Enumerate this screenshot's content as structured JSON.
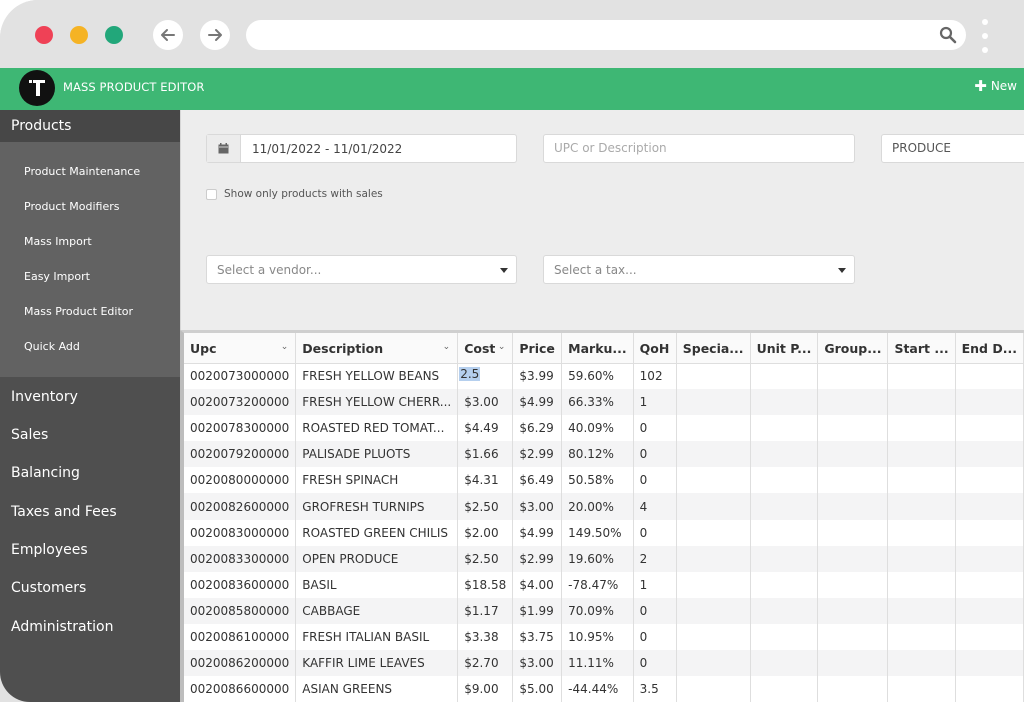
{
  "browser": {
    "traffic_lights": [
      "close",
      "minimize",
      "maximize"
    ],
    "url": ""
  },
  "app": {
    "title": "MASS PRODUCT EDITOR",
    "new_label": "New",
    "brand_color": "#3eb774"
  },
  "sidebar": {
    "active_section": "Products",
    "sub_items": [
      {
        "label": "Product Maintenance"
      },
      {
        "label": "Product Modifiers"
      },
      {
        "label": "Mass Import"
      },
      {
        "label": "Easy Import"
      },
      {
        "label": "Mass Product Editor"
      },
      {
        "label": "Quick Add"
      }
    ],
    "sections": [
      {
        "label": "Inventory"
      },
      {
        "label": "Sales"
      },
      {
        "label": "Balancing"
      },
      {
        "label": "Taxes and Fees"
      },
      {
        "label": "Employees"
      },
      {
        "label": "Customers"
      },
      {
        "label": "Administration"
      }
    ]
  },
  "filters": {
    "date_range": "11/01/2022 - 11/01/2022",
    "search_placeholder": "UPC or Description",
    "search_value": "",
    "department": "PRODUCE",
    "show_only_with_sales_label": "Show only products with sales",
    "show_only_with_sales_checked": false,
    "vendor_placeholder": "Select a vendor...",
    "tax_placeholder": "Select a tax..."
  },
  "grid": {
    "columns": [
      {
        "label": "Upc"
      },
      {
        "label": "Description"
      },
      {
        "label": "Cost"
      },
      {
        "label": "Price"
      },
      {
        "label": "Marku..."
      },
      {
        "label": "QoH"
      },
      {
        "label": "Specia..."
      },
      {
        "label": "Unit P..."
      },
      {
        "label": "Group..."
      },
      {
        "label": "Start ..."
      },
      {
        "label": "End D..."
      }
    ],
    "editing_value": "2.5",
    "rows": [
      {
        "upc": "0020073000000",
        "description": "FRESH YELLOW BEANS",
        "cost": "2.5",
        "price": "$3.99",
        "markup": "59.60%",
        "qoh": "102"
      },
      {
        "upc": "0020073200000",
        "description": "FRESH YELLOW CHERR...",
        "cost": "$3.00",
        "price": "$4.99",
        "markup": "66.33%",
        "qoh": "1"
      },
      {
        "upc": "0020078300000",
        "description": "ROASTED RED TOMAT...",
        "cost": "$4.49",
        "price": "$6.29",
        "markup": "40.09%",
        "qoh": "0"
      },
      {
        "upc": "0020079200000",
        "description": "PALISADE PLUOTS",
        "cost": "$1.66",
        "price": "$2.99",
        "markup": "80.12%",
        "qoh": "0"
      },
      {
        "upc": "0020080000000",
        "description": "FRESH SPINACH",
        "cost": "$4.31",
        "price": "$6.49",
        "markup": "50.58%",
        "qoh": "0"
      },
      {
        "upc": "0020082600000",
        "description": "GROFRESH TURNIPS",
        "cost": "$2.50",
        "price": "$3.00",
        "markup": "20.00%",
        "qoh": "4"
      },
      {
        "upc": "0020083000000",
        "description": "ROASTED GREEN CHILIS",
        "cost": "$2.00",
        "price": "$4.99",
        "markup": "149.50%",
        "qoh": "0"
      },
      {
        "upc": "0020083300000",
        "description": "OPEN PRODUCE",
        "cost": "$2.50",
        "price": "$2.99",
        "markup": "19.60%",
        "qoh": "2"
      },
      {
        "upc": "0020083600000",
        "description": "BASIL",
        "cost": "$18.58",
        "price": "$4.00",
        "markup": "-78.47%",
        "qoh": "1"
      },
      {
        "upc": "0020085800000",
        "description": "CABBAGE",
        "cost": "$1.17",
        "price": "$1.99",
        "markup": "70.09%",
        "qoh": "0"
      },
      {
        "upc": "0020086100000",
        "description": "FRESH ITALIAN BASIL",
        "cost": "$3.38",
        "price": "$3.75",
        "markup": "10.95%",
        "qoh": "0"
      },
      {
        "upc": "0020086200000",
        "description": "KAFFIR LIME LEAVES",
        "cost": "$2.70",
        "price": "$3.00",
        "markup": "11.11%",
        "qoh": "0"
      },
      {
        "upc": "0020086600000",
        "description": "ASIAN GREENS",
        "cost": "$9.00",
        "price": "$5.00",
        "markup": "-44.44%",
        "qoh": "3.5"
      }
    ]
  }
}
